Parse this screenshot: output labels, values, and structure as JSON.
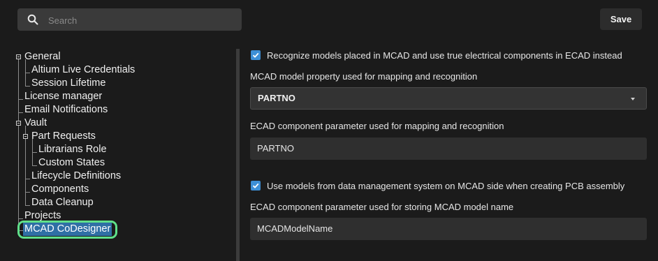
{
  "search": {
    "placeholder": "Search",
    "value": ""
  },
  "toolbar": {
    "save_label": "Save"
  },
  "tree": {
    "general": "General",
    "altium_live_credentials": "Altium Live Credentials",
    "session_lifetime": "Session Lifetime",
    "license_manager": "License manager",
    "email_notifications": "Email Notifications",
    "vault": "Vault",
    "part_requests": "Part Requests",
    "librarians_role": "Librarians Role",
    "custom_states": "Custom States",
    "lifecycle_definitions": "Lifecycle Definitions",
    "components": "Components",
    "data_cleanup": "Data Cleanup",
    "projects": "Projects",
    "mcad_codesigner": "MCAD CoDesigner"
  },
  "settings": {
    "recognize_checkbox": {
      "checked": true,
      "label": "Recognize models placed in MCAD and use true electrical components in ECAD instead"
    },
    "mcad_property_label": "MCAD model property used for mapping and recognition",
    "mcad_property_value": "PARTNO",
    "ecad_param_label": "ECAD component parameter used for mapping and recognition",
    "ecad_param_value": "PARTNO",
    "use_models_checkbox": {
      "checked": true,
      "label": "Use models from data management system on MCAD side when creating PCB assembly"
    },
    "ecad_storing_label": "ECAD component parameter used for storing MCAD model name",
    "ecad_storing_value": "MCADModelName"
  },
  "colors": {
    "accent": "#3d8fd6",
    "selection": "#2f6fa5",
    "highlight_ring": "#5fe08a",
    "background": "#1b1b1b"
  }
}
